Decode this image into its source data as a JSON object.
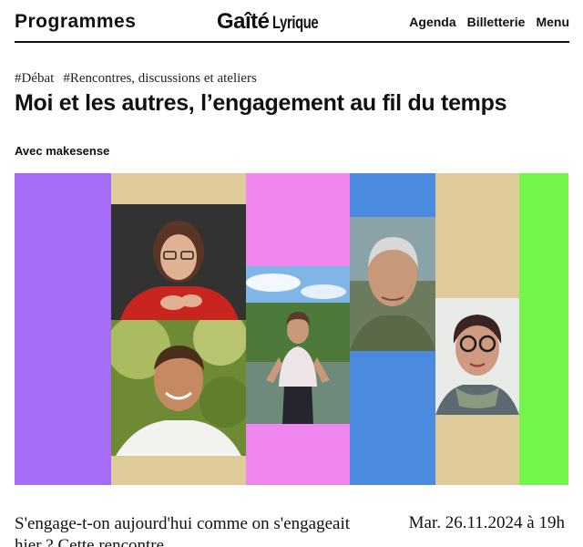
{
  "header": {
    "programmes": "Programmes",
    "logo_main": "Gaîté",
    "logo_sub": "Lyrique",
    "nav": [
      "Agenda",
      "Billetterie",
      "Menu"
    ]
  },
  "event": {
    "tags": [
      "#Débat",
      "#Rencontres, discussions et ateliers"
    ],
    "title": "Moi et les autres, l’engagement au fil du temps",
    "subtitle": "Avec makesense",
    "lead": "S'engage-t-on aujourd'hui comme on s'engageait hier ? Cette rencontre",
    "date": "Mar. 26.11.2024 à 19h"
  },
  "banner": {
    "colors": {
      "purple": "#a56cf6",
      "tan": "#dfca9a",
      "pink": "#ef86ee",
      "blue": "#4a8be0",
      "green": "#75f54c"
    }
  }
}
